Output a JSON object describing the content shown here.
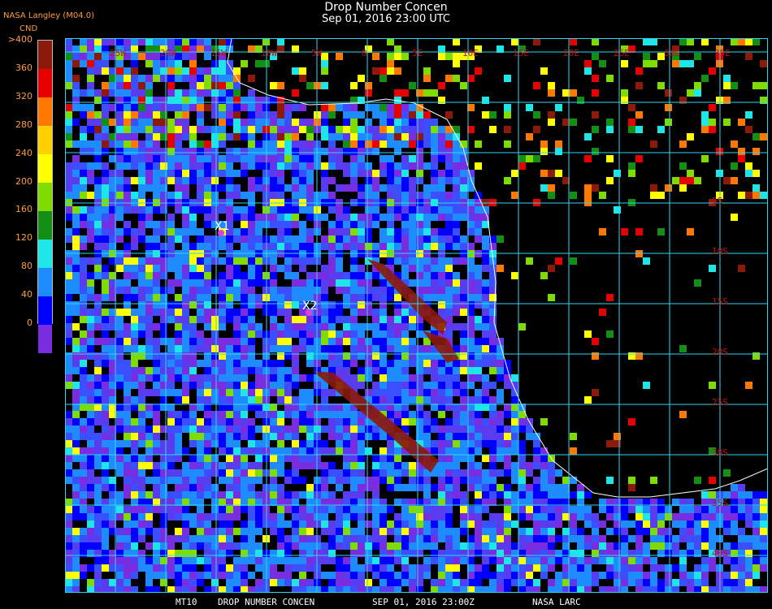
{
  "header": {
    "title": "Drop Number Concen",
    "subtitle": "Sep 01, 2016 23:00 UTC"
  },
  "source_label": "NASA Langley (M04.0)",
  "colorbar": {
    "unit": "CND",
    "labels": [
      ">400",
      "360",
      "320",
      "280",
      "240",
      "200",
      "160",
      "120",
      "80",
      "40",
      "0"
    ],
    "colors": [
      "#8b1a0a",
      "#e60000",
      "#ff7800",
      "#ffd000",
      "#ffff00",
      "#7fdc00",
      "#139013",
      "#1ee6e6",
      "#1e8cff",
      "#0000ff",
      "#7a2de0"
    ]
  },
  "map": {
    "lon_labels": [
      "25W",
      "20W",
      "15W",
      "10W",
      "5W",
      "0",
      "5E",
      "10E",
      "15E",
      "20E",
      "25E",
      "30E",
      "35E"
    ],
    "lat_labels": [
      "5S",
      "10S",
      "15S",
      "20S",
      "25S",
      "30S",
      "35S",
      "40S"
    ],
    "markers": [
      {
        "label": "X1"
      },
      {
        "label": "X2"
      }
    ],
    "colors": {
      "grid": "#2fd6f0",
      "coast": "#ffffff",
      "marker": "#e040e0",
      "grid_label": "#c01010"
    }
  },
  "footer": {
    "product": "MT10",
    "parameter": "DROP NUMBER CONCEN",
    "datetime": "SEP 01, 2016 23:00Z",
    "org": "NASA LARC"
  }
}
